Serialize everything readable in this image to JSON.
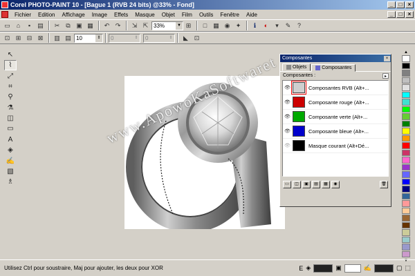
{
  "window": {
    "title": "Corel PHOTO-PAINT 10 - [Bague 1 (RVB 24 bits) @33% - Fond]",
    "buttons": [
      "_",
      "□",
      "×"
    ]
  },
  "menubar": {
    "items": [
      "Fichier",
      "Edition",
      "Affichage",
      "Image",
      "Effets",
      "Masque",
      "Objet",
      "Film",
      "Outils",
      "Fenêtre",
      "Aide"
    ],
    "doc_buttons": [
      "_",
      "□",
      "×"
    ]
  },
  "toolbar": {
    "zoom_value": "33%",
    "spin_value": "10",
    "spin2_value": "0",
    "spin3_value": "0"
  },
  "watermark": "www.ApowoKaSoftwaret",
  "docker": {
    "title": "Composantes",
    "tabs": [
      {
        "label": "Objets"
      },
      {
        "label": "Composantes"
      }
    ],
    "subheader": "Composantes :",
    "channels": [
      {
        "label": "Composantes RVB (Alt+...",
        "color": "#cfcfcf"
      },
      {
        "label": "Composante rouge (Alt+...",
        "color": "#cc0000"
      },
      {
        "label": "Composante verte (Alt+...",
        "color": "#00aa00"
      },
      {
        "label": "Composante bleue (Alt+...",
        "color": "#0000cc"
      },
      {
        "label": "Masque courant (Alt+Dé...",
        "color": "#000000"
      }
    ]
  },
  "palette": {
    "colors": [
      "#ffffff",
      "#000000",
      "#808080",
      "#c0c0c0",
      "#e0e0e0",
      "#00ffff",
      "#40e0d0",
      "#00ff00",
      "#66cc33",
      "#008000",
      "#ffff00",
      "#ff9900",
      "#ff0000",
      "#cc3366",
      "#ff66cc",
      "#9933cc",
      "#6666ff",
      "#0000ff",
      "#000080",
      "#336699",
      "#ff9999",
      "#ffcc99",
      "#996633",
      "#663300",
      "#cccc99",
      "#99cccc",
      "#9999cc",
      "#cc99cc"
    ]
  },
  "status": {
    "text": "Utilisez Ctrl pour soustraire, Maj pour ajouter, les deux pour XOR",
    "letter": "E"
  }
}
